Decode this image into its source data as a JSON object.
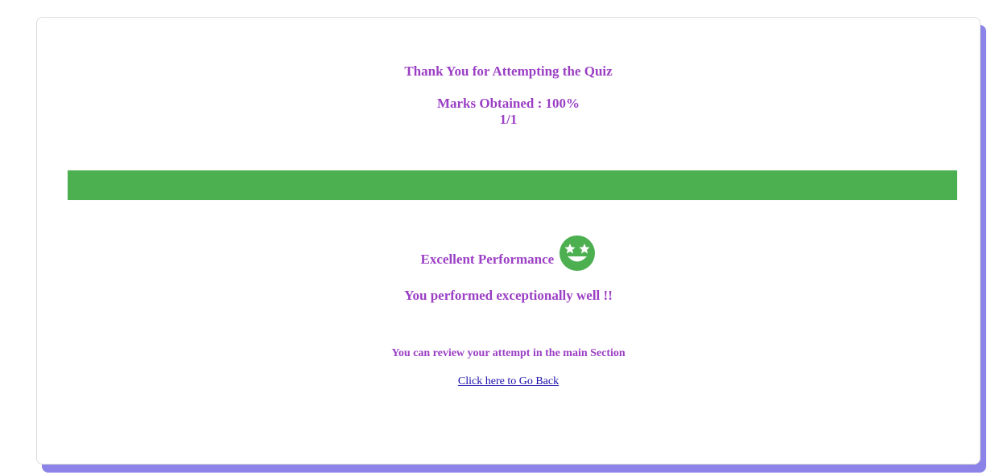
{
  "result": {
    "title": "Thank You for Attempting the Quiz",
    "marks_line": "Marks Obtained : 100%",
    "score_fraction": "1/1",
    "progress_percent": 100,
    "progress_color": "#4caf50",
    "performance_label": "Excellent Performance",
    "performance_icon": "star-eyes-emoji-icon",
    "performance_message": "You performed exceptionally well !!",
    "review_note": "You can review your attempt in the main Section",
    "back_link_label": "Click here to Go Back"
  },
  "colors": {
    "text_accent": "#9b3fc4",
    "card_shadow": "#8b83e8",
    "link": "#1a0dab"
  }
}
